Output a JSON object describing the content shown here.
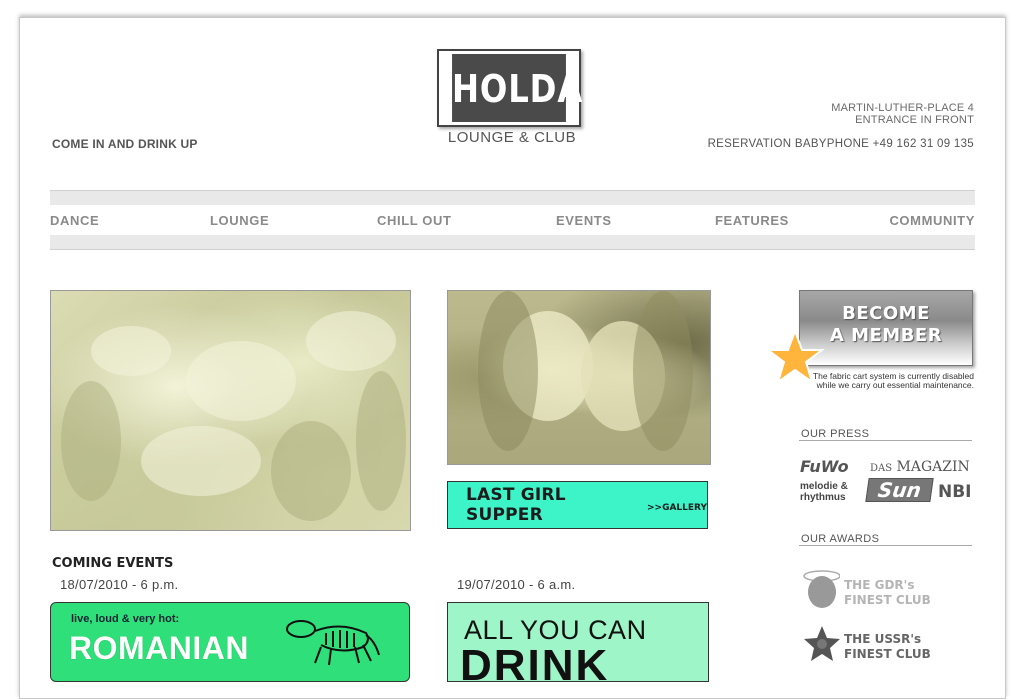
{
  "header": {
    "tagline": "COME IN AND DRINK UP",
    "logo": {
      "name": "HOLDA",
      "sub": "LOUNGE & CLUB"
    },
    "address": {
      "line1": "MARTIN-LUTHER-PLACE 4",
      "line2": "ENTRANCE IN FRONT"
    },
    "phone": "RESERVATION BABYPHONE +49 162 31 09 135"
  },
  "nav": {
    "items": [
      {
        "label": "DANCE"
      },
      {
        "label": "LOUNGE"
      },
      {
        "label": "CHILL OUT"
      },
      {
        "label": "EVENTS"
      },
      {
        "label": "FEATURES"
      },
      {
        "label": "COMMUNITY"
      }
    ]
  },
  "main": {
    "gallery_link": {
      "label": "LAST GIRL SUPPER",
      "sub": ">>GALLERY",
      "bg": "#3df3c8"
    },
    "coming_events_title": "COMING EVENTS",
    "events": [
      {
        "date": "18/07/2010 - 6 p.m.",
        "kicker": "live, loud & very hot:",
        "title": "ROMANIAN",
        "bg": "#2fe07a"
      },
      {
        "date": "19/07/2010 - 6 a.m.",
        "line1": "ALL YOU CAN",
        "line2": "DRINK",
        "bg": "#9ef5c8"
      }
    ]
  },
  "sidebar": {
    "member_button": {
      "line1": "BECOME",
      "line2": "A MEMBER"
    },
    "notice": "The fabric cart system is currently disabled while we carry out essential maintenance.",
    "press": {
      "title": "OUR PRESS",
      "logos": {
        "fuwo": "FuWo",
        "das": "DAS",
        "magazin": "MAGAZIN",
        "melodie1": "melodie &",
        "melodie2": "rhythmus",
        "sun": "Sun",
        "nbi": "NBI"
      }
    },
    "awards": {
      "title": "OUR AWARDS",
      "items": [
        {
          "line1": "THE GDR's",
          "line2": "FINEST CLUB",
          "icon": "halo-icon"
        },
        {
          "line1": "THE USSR's",
          "line2": "FINEST CLUB",
          "icon": "star-badge-icon"
        }
      ]
    }
  }
}
